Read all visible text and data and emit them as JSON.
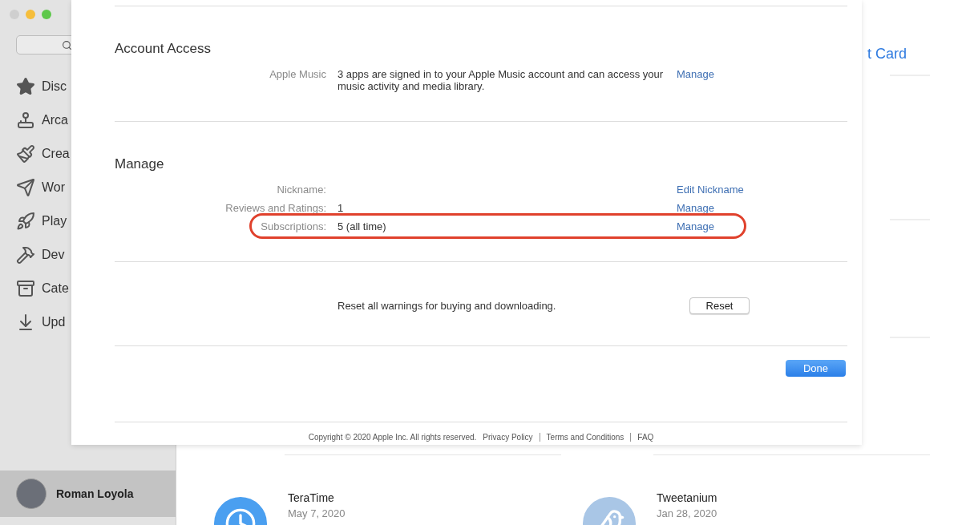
{
  "sidebar": {
    "items": [
      {
        "label": "Disc",
        "selected": false
      },
      {
        "label": "Arca",
        "selected": false
      },
      {
        "label": "Crea",
        "selected": false
      },
      {
        "label": "Wor",
        "selected": false
      },
      {
        "label": "Play",
        "selected": false
      },
      {
        "label": "Dev",
        "selected": false
      },
      {
        "label": "Cate",
        "selected": false
      },
      {
        "label": "Upd",
        "selected": false
      }
    ],
    "user": {
      "name": "Roman Loyola",
      "selected": true
    }
  },
  "background": {
    "link": "t Card",
    "apps": [
      {
        "name": "TeraTime",
        "date": "May 7, 2020"
      },
      {
        "name": "Tweetanium",
        "date": "Jan 28, 2020"
      }
    ]
  },
  "sheet": {
    "sections": [
      {
        "title": "Account Access",
        "rows": [
          {
            "label": "Apple Music",
            "value": "3 apps are signed in to your Apple Music account and can access your music activity and media library.",
            "action": "Manage",
            "highlighted": false
          }
        ]
      },
      {
        "title": "Manage",
        "rows": [
          {
            "label": "Nickname:",
            "action": "Edit Nickname",
            "highlighted": false
          },
          {
            "label": "Reviews and Ratings:",
            "value": "1",
            "action": "Manage",
            "highlighted": false
          },
          {
            "label": "Subscriptions:",
            "value": "5 (all time)",
            "action": "Manage",
            "highlighted": true
          }
        ]
      }
    ],
    "reset": {
      "text": "Reset all warnings for buying and downloading.",
      "button": "Reset"
    },
    "done_button": "Done",
    "footer": {
      "copyright": "Copyright © 2020 Apple Inc. All rights reserved.",
      "links": [
        "Privacy Policy",
        "Terms and Conditions",
        "FAQ"
      ]
    }
  }
}
